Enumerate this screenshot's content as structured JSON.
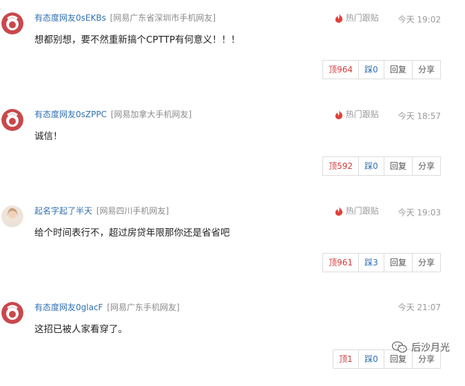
{
  "comments": [
    {
      "author": "有态度网友0sEKBs",
      "location": "[网易广东省深圳市手机网友]",
      "hot": "热门跟贴",
      "time": "今天 19:02",
      "text": "想都别想，要不然重新搞个CPTTP有何意义！！！",
      "up": "顶964",
      "down": "踩0",
      "reply": "回复",
      "share": "分享"
    },
    {
      "author": "有态度网友0sZPPC",
      "location": "[网易加拿大手机网友]",
      "hot": "热门跟贴",
      "time": "今天 18:57",
      "text": "诚信！",
      "up": "顶592",
      "down": "踩0",
      "reply": "回复",
      "share": "分享"
    },
    {
      "author": "起名字起了半天",
      "location": "[网易四川手机网友]",
      "hot": "热门跟贴",
      "time": "今天 19:03",
      "text": "给个时间表行不，超过房贷年限那你还是省省吧",
      "up": "顶961",
      "down": "踩3",
      "reply": "回复",
      "share": "分享"
    },
    {
      "author": "有态度网友0glacF",
      "location": "[网易广东手机网友]",
      "hot": "",
      "time": "今天 21:07",
      "text": "这招已被人家看穿了。",
      "up": "顶1",
      "down": "踩0",
      "reply": "回复",
      "share": "分享"
    }
  ],
  "watermark": "后沙月光",
  "colors": {
    "author": "#2f6fb0",
    "up": "#d23b3b",
    "hot_icon": "#e0423a",
    "avatar_red": "#c9484c"
  }
}
